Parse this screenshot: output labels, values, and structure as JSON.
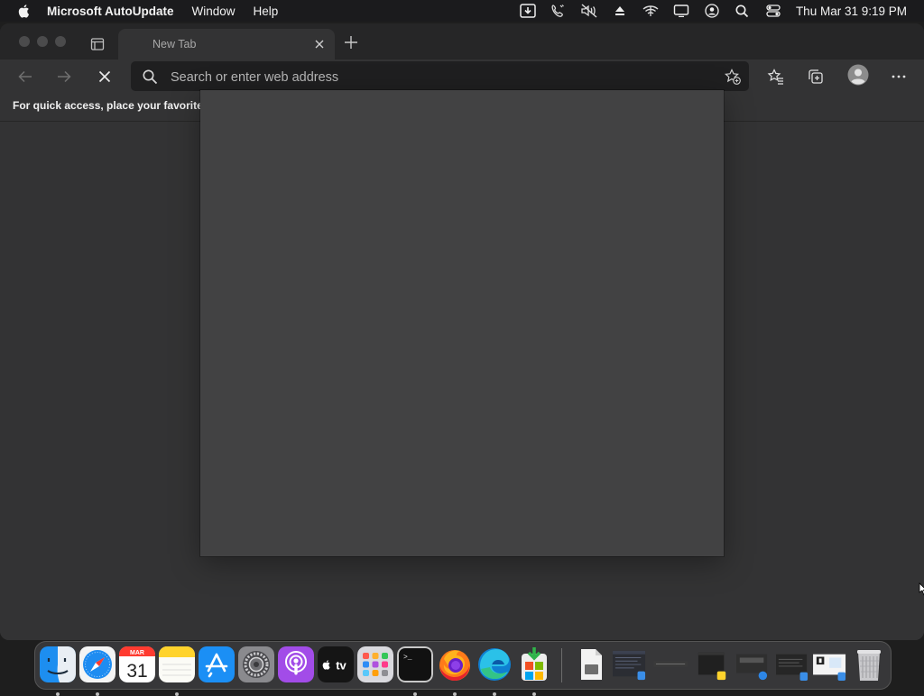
{
  "menubar": {
    "app_name": "Microsoft AutoUpdate",
    "menus": [
      "Window",
      "Help"
    ],
    "clock": "Thu Mar 31  9:19 PM"
  },
  "browser": {
    "tab_title": "New Tab",
    "address_placeholder": "Search or enter web address",
    "address_value": "",
    "favorites_bar_text": "For quick access, place your favorite"
  },
  "dock": {
    "apps": [
      "Finder",
      "Safari",
      "Calendar",
      "Notes",
      "App Store",
      "System Preferences",
      "Podcasts",
      "TV",
      "Launchpad",
      "Terminal",
      "Firefox",
      "Microsoft Edge",
      "Microsoft AutoUpdate"
    ],
    "calendar": {
      "month": "MAR",
      "day": "31"
    },
    "tv_label": "tv",
    "terminal_prompt": ">_"
  }
}
